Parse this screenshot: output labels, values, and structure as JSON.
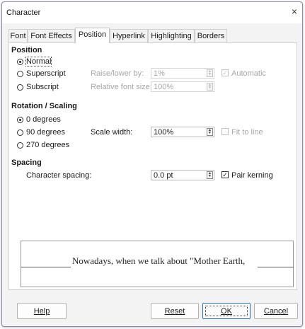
{
  "window": {
    "title": "Character",
    "close_icon": "×"
  },
  "tabs": [
    {
      "label": "Font",
      "active": false
    },
    {
      "label": "Font Effects",
      "active": false
    },
    {
      "label": "Position",
      "active": true
    },
    {
      "label": "Hyperlink",
      "active": false
    },
    {
      "label": "Highlighting",
      "active": false
    },
    {
      "label": "Borders",
      "active": false
    }
  ],
  "position_section": {
    "heading": "Position",
    "normal_label": "Normal",
    "superscript_label": "Superscript",
    "subscript_label": "Subscript",
    "selected": "Normal",
    "raise_lower_label": "Raise/lower by:",
    "raise_lower_value": "1%",
    "relative_font_size_label": "Relative font size:",
    "relative_font_size_value": "100%",
    "automatic_label": "Automatic",
    "automatic_checked": true
  },
  "rotation_section": {
    "heading": "Rotation / Scaling",
    "deg0_label": "0 degrees",
    "deg90_label": "90 degrees",
    "deg270_label": "270 degrees",
    "selected": "0 degrees",
    "scale_width_label": "Scale width:",
    "scale_width_value": "100%",
    "fit_to_line_label": "Fit to line",
    "fit_to_line_checked": false
  },
  "spacing_section": {
    "heading": "Spacing",
    "character_spacing_label": "Character spacing:",
    "character_spacing_value": "0.0 pt",
    "pair_kerning_label": "Pair kerning",
    "pair_kerning_checked": true
  },
  "preview": {
    "text": "Nowadays, when we talk about \"Mother Earth,"
  },
  "buttons": {
    "help": "Help",
    "reset": "Reset",
    "ok": "OK",
    "cancel": "Cancel"
  },
  "icons": {
    "spin": "spin-up-down-icon",
    "check_mark": "✓"
  }
}
